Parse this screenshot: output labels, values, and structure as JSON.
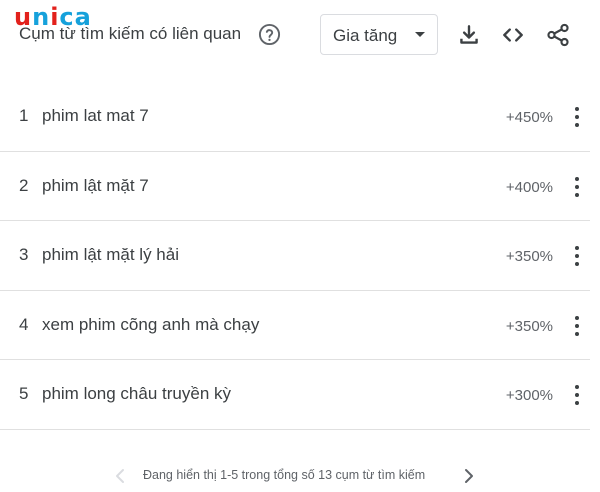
{
  "logo": {
    "letters": [
      "u",
      "n",
      "i",
      "c",
      "a"
    ],
    "colors": [
      "#e2211c",
      "#16a1db",
      "#e2211c",
      "#16a1db",
      "#16a1db"
    ]
  },
  "header": {
    "title": "Cụm từ tìm kiếm có liên quan",
    "help_icon": "help-circle-icon",
    "sort_select": {
      "value": "Gia tăng"
    },
    "icons": [
      "download-icon",
      "embed-code-icon",
      "share-icon"
    ]
  },
  "rows": [
    {
      "rank": "1",
      "term": "phim lat mat 7",
      "value": "+450%"
    },
    {
      "rank": "2",
      "term": "phim lật mặt 7",
      "value": "+400%"
    },
    {
      "rank": "3",
      "term": "phim lật mặt lý hải",
      "value": "+350%"
    },
    {
      "rank": "4",
      "term": "xem phim cõng anh mà chạy",
      "value": "+350%"
    },
    {
      "rank": "5",
      "term": "phim long châu truyền kỳ",
      "value": "+300%"
    }
  ],
  "pager": {
    "text": "Đang hiển thị 1-5 trong tổng số 13 cụm từ tìm kiếm"
  },
  "colors": {
    "text": "#3c4043",
    "muted": "#5f6368",
    "divider": "#e0e0e0"
  }
}
